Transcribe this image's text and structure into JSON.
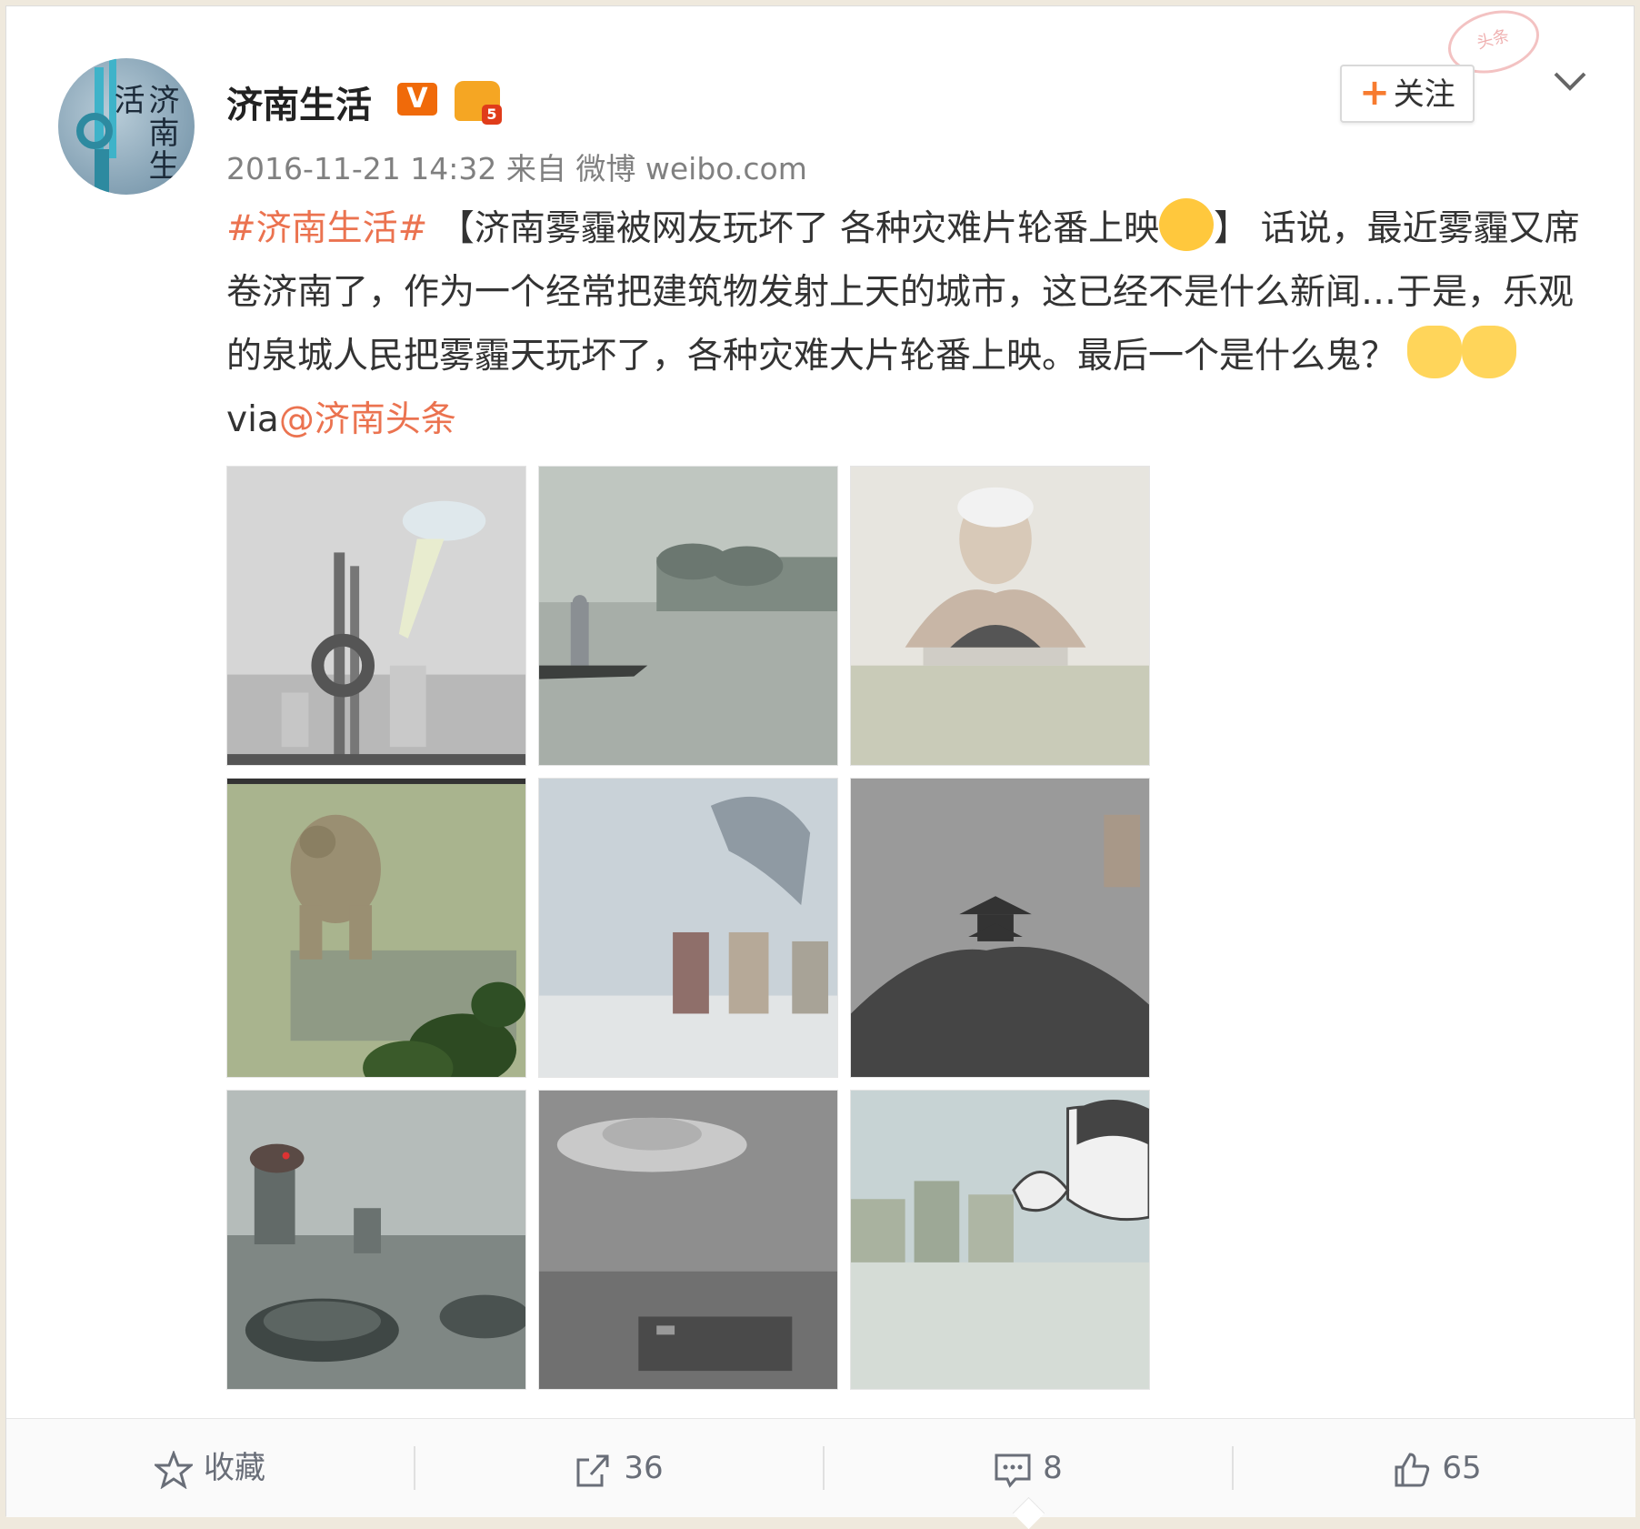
{
  "post": {
    "username": "济南生活",
    "vip_badge": "V",
    "level_badge": "5",
    "timestamp": "2016-11-21 14:32",
    "source": "来自 微博 weibo.com",
    "follow_label": "关注",
    "text": {
      "hashtag": "#济南生活#",
      "headline": "【济南雾霾被网友玩坏了 各种灾难片轮番上映",
      "headline_close": "】",
      "body": "话说，最近雾霾又席卷济南了，作为一个经常把建筑物发射上天的城市，这已经不是什么新闻…于是，乐观的泉城人民把雾霾天玩坏了，各种灾难大片轮番上映。最后一个是什么鬼？",
      "via": "via",
      "mention": "@济南头条"
    },
    "avatar_text": "济南生活",
    "stamp_text": "头条"
  },
  "images": [
    {
      "name": "photo-ufo-monument"
    },
    {
      "name": "photo-boat-lake"
    },
    {
      "name": "photo-swimmer-fog"
    },
    {
      "name": "photo-giant-green"
    },
    {
      "name": "photo-dragon-towers"
    },
    {
      "name": "photo-pavilion-hill"
    },
    {
      "name": "photo-monster-stadium"
    },
    {
      "name": "photo-ufo-city"
    },
    {
      "name": "photo-facepalm-city"
    }
  ],
  "actions": {
    "favorite_label": "收藏",
    "repost_count": "36",
    "comment_count": "8",
    "like_count": "65"
  },
  "colors": {
    "link": "#eb7350",
    "follow_plus": "#f77b2f",
    "vip_badge": "#f06a0a"
  }
}
